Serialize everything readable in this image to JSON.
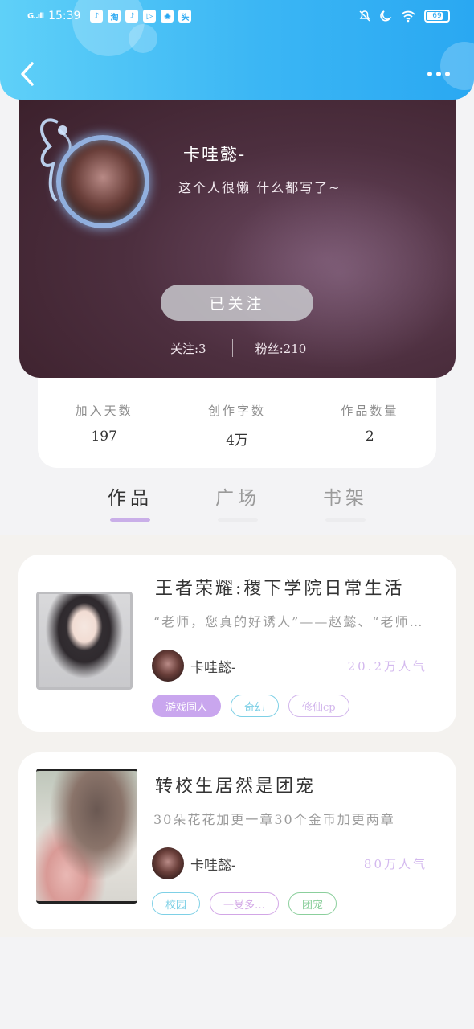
{
  "status_bar": {
    "signal": "G..ıll",
    "time": "15:39",
    "apps": [
      "♪",
      "淘",
      "♪",
      "▷",
      "◉",
      "头"
    ],
    "icons": [
      "mute-icon",
      "moon-icon",
      "wifi-icon"
    ],
    "battery": "69"
  },
  "header": {
    "back_icon": "chevron-left-icon",
    "more_icon": "more-dots-icon"
  },
  "profile": {
    "username": "卡哇懿-",
    "bio": "这个人很懒 什么都写了~",
    "follow_label": "已关注",
    "following": "关注:3",
    "fans": "粉丝:210"
  },
  "stats": [
    {
      "label": "加入天数",
      "value": "197"
    },
    {
      "label": "创作字数",
      "value": "4万"
    },
    {
      "label": "作品数量",
      "value": "2"
    }
  ],
  "tabs": [
    {
      "label": "作品",
      "active": true
    },
    {
      "label": "广场",
      "active": false
    },
    {
      "label": "书架",
      "active": false
    }
  ],
  "works": [
    {
      "title": "王者荣耀:稷下学院日常生活",
      "desc": "“老师，您真的好诱人”——赵懿、“老师，您真的好诱人”",
      "author": "卡哇懿-",
      "popularity": "20.2万人气",
      "tags": [
        {
          "label": "游戏同人",
          "color": "#c9a6ee",
          "filled": true
        },
        {
          "label": "奇幻",
          "color": "#7ed0e6",
          "filled": false
        },
        {
          "label": "修仙cp",
          "color": "#d2b6ec",
          "filled": false
        }
      ]
    },
    {
      "title": "转校生居然是团宠",
      "desc": "30朵花花加更一章30个金币加更两章",
      "author": "卡哇懿-",
      "popularity": "80万人气",
      "tags": [
        {
          "label": "校园",
          "color": "#7ed0e6",
          "filled": false
        },
        {
          "label": "一受多…",
          "color": "#d2a6e6",
          "filled": false
        },
        {
          "label": "团宠",
          "color": "#8bcf9c",
          "filled": false
        }
      ]
    }
  ]
}
